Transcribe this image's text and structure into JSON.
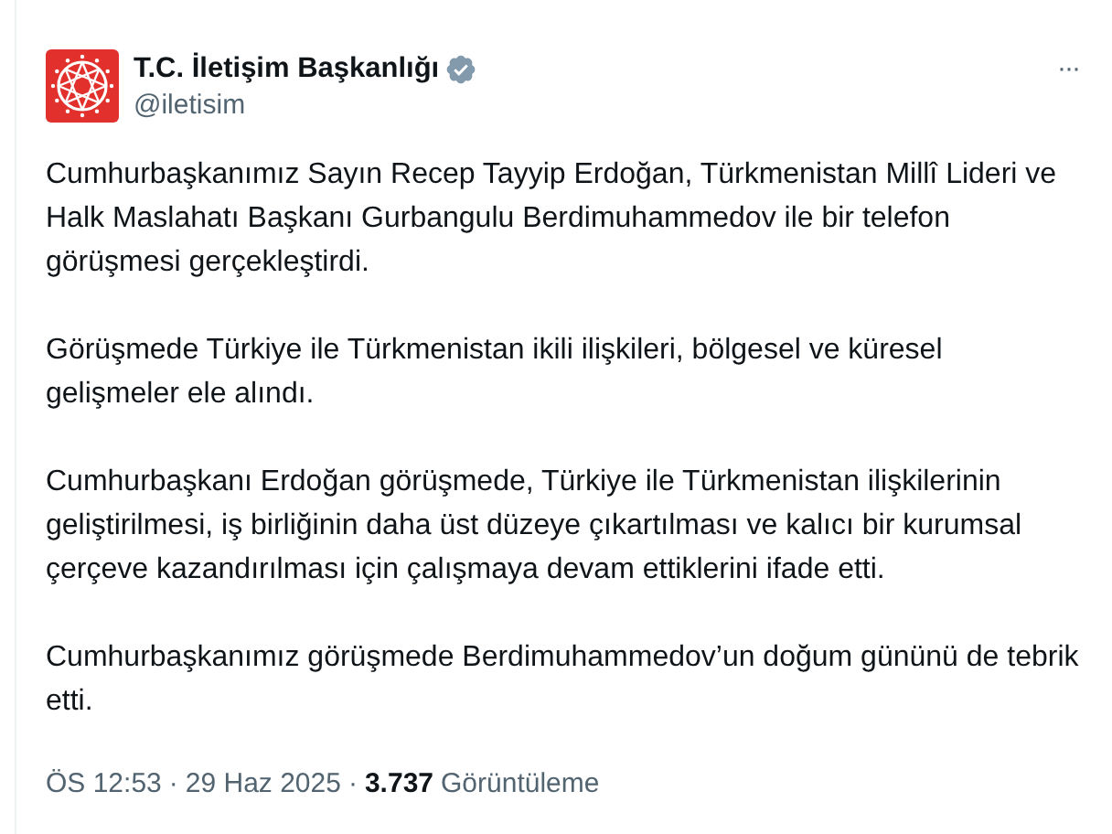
{
  "author": {
    "name": "T.C. İletişim Başkanlığı",
    "verified": true,
    "handle": "@iletisim"
  },
  "menu": {
    "label": "···"
  },
  "paragraphs": [
    "Cumhurbaşkanımız Sayın Recep Tayyip Erdoğan, Türkmenistan Millî Lideri ve Halk Maslahatı Başkanı Gurbangulu Berdimuhammedov ile bir telefon görüşmesi gerçekleştirdi.",
    "Görüşmede Türkiye ile Türkmenistan ikili ilişkileri, bölgesel ve küresel gelişmeler ele alındı.",
    "Cumhurbaşkanı Erdoğan görüşmede, Türkiye ile Türkmenistan ilişkilerinin geliştirilmesi, iş birliğinin daha üst düzeye çıkartılması ve kalıcı bir kurumsal çerçeve kazandırılması için çalışmaya devam ettiklerini ifade etti.",
    "Cumhurbaşkanımız görüşmede Berdimuhammedov’un doğum gününü de tebrik etti."
  ],
  "footer": {
    "time": "ÖS 12:53",
    "separators": [
      "·",
      "·"
    ],
    "date": "29 Haz 2025",
    "views": "3.737",
    "views_label": "Görüntüleme"
  }
}
